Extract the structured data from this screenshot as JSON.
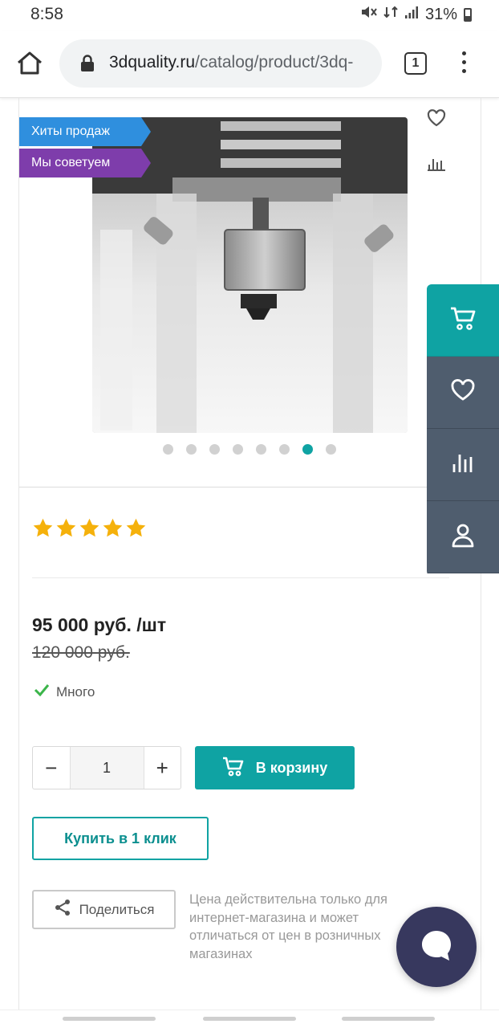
{
  "status": {
    "time": "8:58",
    "battery": "31%"
  },
  "browser": {
    "url_domain": "3dquality.ru",
    "url_path": "/catalog/product/3dq-",
    "tab_count": "1"
  },
  "badges": {
    "hits": "Хиты продаж",
    "recommend": "Мы советуем"
  },
  "gallery": {
    "dot_count": 8,
    "active_index": 6
  },
  "rating": {
    "stars": 5,
    "max": 5
  },
  "product": {
    "price": "95 000 руб. /шт",
    "old_price": "120 000 руб.",
    "stock": "Много"
  },
  "purchase": {
    "quantity": "1",
    "minus": "−",
    "plus": "+",
    "add_to_cart": "В корзину",
    "buy_one_click": "Купить в 1 клик",
    "share": "Поделиться",
    "price_note": "Цена действительна только для интернет-магазина и может отличаться от цен в розничных магазинах"
  },
  "colors": {
    "accent": "#0fa3a3",
    "panel": "#4f5d6e",
    "hits_badge": "#2f8fde",
    "recommend_badge": "#7e3dab",
    "star": "#f5b10b"
  }
}
